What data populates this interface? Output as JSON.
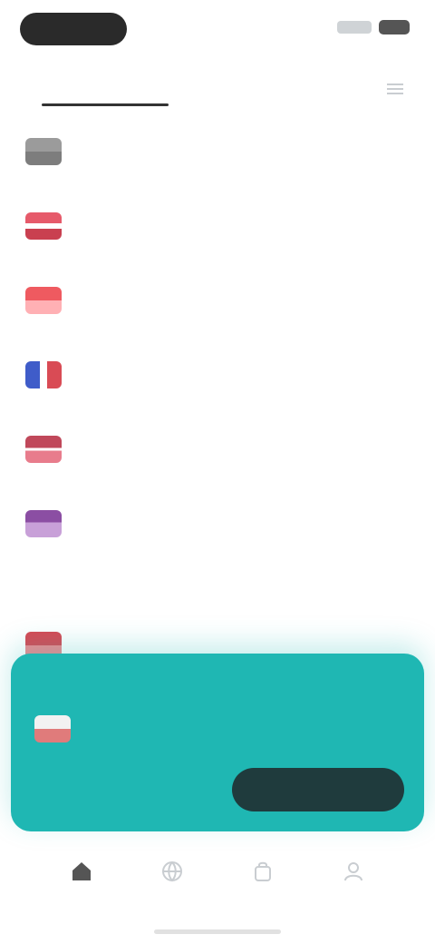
{
  "status_bar": {
    "time": "",
    "icons": [
      "signal-icon",
      "battery-icon"
    ]
  },
  "tabs": {
    "active": "",
    "inactive": "",
    "menu_icon": "menu-icon"
  },
  "list": [
    {
      "title": "",
      "subtitle": "",
      "flag_colors": [
        "#9b9b9b",
        "#7d7d7d"
      ]
    },
    {
      "title": "",
      "subtitle": "",
      "flag_colors": [
        "#e65a6a",
        "#c94050"
      ]
    },
    {
      "title": "",
      "subtitle": "",
      "flag_colors": [
        "#ef5a60",
        "#ff9a9f"
      ]
    },
    {
      "title": "",
      "subtitle": "",
      "flag_colors": [
        "#3f5cc9",
        "#d94b55"
      ]
    },
    {
      "title": "",
      "subtitle": "",
      "flag_colors": [
        "#c0485a",
        "#e87c8c"
      ]
    },
    {
      "title": "",
      "subtitle": "",
      "flag_colors": [
        "#8b4ea3",
        "#c8a0d8"
      ]
    }
  ],
  "section": {
    "label": ""
  },
  "card": {
    "caption": "",
    "title": "",
    "subtitle": "",
    "link": "",
    "button_label": "",
    "flag_colors": [
      "#f2f2f2",
      "#e07b7b"
    ]
  },
  "bottom_nav": [
    {
      "label": "",
      "icon": "home-icon",
      "active": true
    },
    {
      "label": "",
      "icon": "globe-icon",
      "active": false
    },
    {
      "label": "",
      "icon": "bag-icon",
      "active": false
    },
    {
      "label": "",
      "icon": "profile-icon",
      "active": false
    }
  ]
}
